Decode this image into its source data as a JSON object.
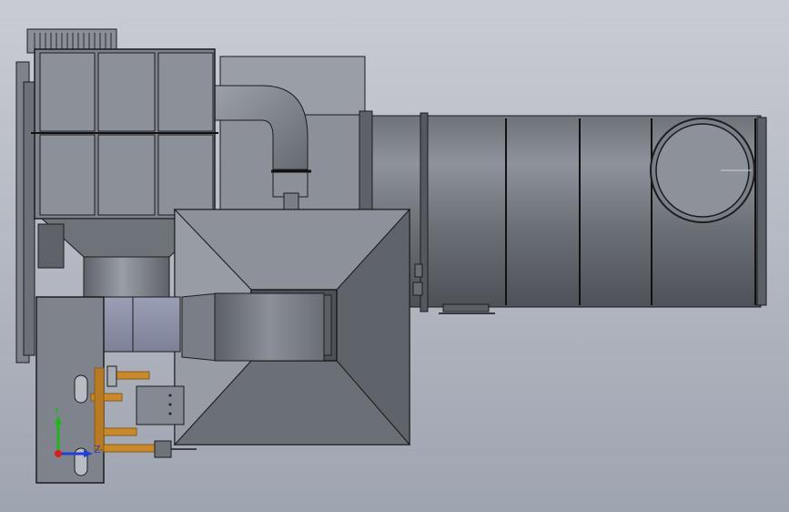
{
  "view": {
    "background_top": "#c9ccd3",
    "background_bottom": "#9ea4b0"
  },
  "colors": {
    "steel_light": "#9a9ea6",
    "steel_mid": "#7c8088",
    "steel_dark": "#4f5359",
    "steel_shadow": "#3c3f44",
    "panel_face": "#8f939b",
    "outline": "#1b1c1f",
    "pipe_orange": "#c98a2e",
    "pipe_orange_dark": "#8a5a18",
    "triad_x": "#d42020",
    "triad_y": "#1fb51f",
    "triad_z": "#2040d8"
  },
  "triad": {
    "x_label": "",
    "y_label": "Y",
    "z_label": "Z"
  }
}
